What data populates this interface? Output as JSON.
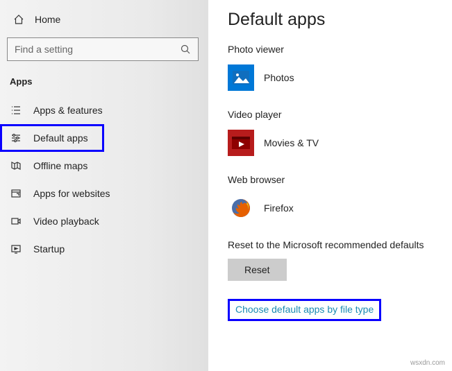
{
  "home_label": "Home",
  "search": {
    "placeholder": "Find a setting"
  },
  "section_title": "Apps",
  "nav": {
    "items": [
      {
        "label": "Apps & features"
      },
      {
        "label": "Default apps"
      },
      {
        "label": "Offline maps"
      },
      {
        "label": "Apps for websites"
      },
      {
        "label": "Video playback"
      },
      {
        "label": "Startup"
      }
    ]
  },
  "page_title": "Default apps",
  "sections": {
    "photo": {
      "label": "Photo viewer",
      "app": "Photos"
    },
    "video": {
      "label": "Video player",
      "app": "Movies & TV"
    },
    "web": {
      "label": "Web browser",
      "app": "Firefox"
    }
  },
  "reset": {
    "text": "Reset to the Microsoft recommended defaults",
    "button": "Reset"
  },
  "link": "Choose default apps by file type",
  "watermark": "wsxdn.com"
}
